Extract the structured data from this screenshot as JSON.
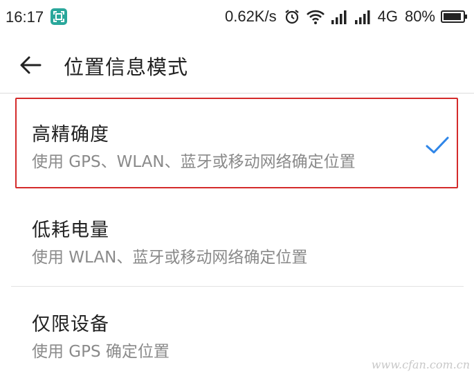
{
  "status_bar": {
    "time": "16:17",
    "network_speed": "0.62K/s",
    "network_type": "4G",
    "battery": "80%",
    "icons": [
      "scan-icon",
      "alarm-icon",
      "wifi-icon",
      "signal-icon",
      "battery-icon"
    ]
  },
  "header": {
    "title": "位置信息模式",
    "back_icon": "arrow-left-icon"
  },
  "options": [
    {
      "title": "高精确度",
      "description": "使用 GPS、WLAN、蓝牙或移动网络确定位置",
      "selected": true
    },
    {
      "title": "低耗电量",
      "description": "使用 WLAN、蓝牙或移动网络确定位置",
      "selected": false
    },
    {
      "title": "仅限设备",
      "description": "使用 GPS 确定位置",
      "selected": false
    }
  ],
  "watermark": "www.cfan.com.cn",
  "colors": {
    "accent": "#2f86e8",
    "highlight_border": "#d42a2a",
    "secondary_text": "#8a8a8a"
  }
}
